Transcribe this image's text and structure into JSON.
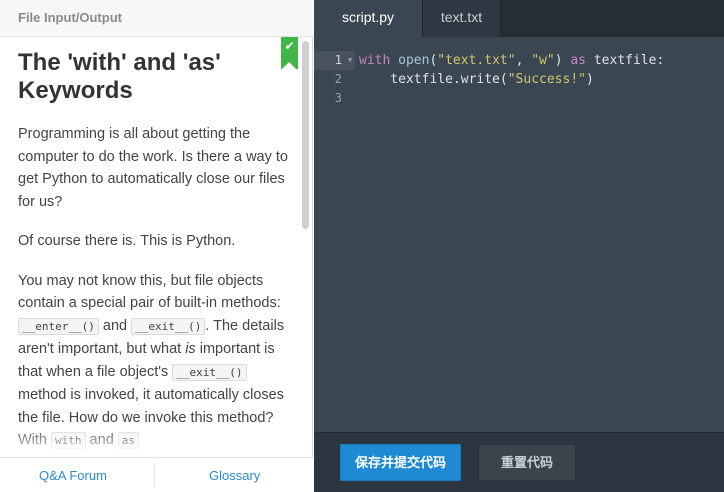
{
  "lesson": {
    "course_title": "File Input/Output",
    "title": "The 'with' and 'as' Keywords",
    "para1": "Programming is all about getting the computer to do the work. Is there a way to get Python to automatically close our files for us?",
    "para2": "Of course there is. This is Python.",
    "para3": {
      "t1": "You may not know this, but file objects contain a special pair of built-in methods: ",
      "c1": "__enter__()",
      "t2": " and ",
      "c2": "__exit__()",
      "t3": ". The details aren't important, but what ",
      "em": "is",
      "t4": " important is that when a file object's ",
      "c3": "__exit__()",
      "t5": " method is invoked, it automatically closes the file. How do we invoke this method? With ",
      "c4": "with",
      "t6": " and ",
      "c5": "as"
    },
    "completed_icon": "check-icon"
  },
  "footer": {
    "qa_label": "Q&A Forum",
    "glossary_label": "Glossary"
  },
  "editor": {
    "tabs": [
      {
        "label": "script.py",
        "active": true
      },
      {
        "label": "text.txt",
        "active": false
      }
    ],
    "line_numbers": [
      "1",
      "2",
      "3"
    ],
    "code": {
      "l1_kw": "with",
      "l1_fn": "open",
      "l1_p1": "(",
      "l1_s1": "\"text.txt\"",
      "l1_p2": ", ",
      "l1_s2": "\"w\"",
      "l1_p3": ") ",
      "l1_kw2": "as",
      "l1_p4": " textfile:",
      "l2_p1": "    textfile.write(",
      "l2_s1": "\"Success!\"",
      "l2_p2": ")"
    }
  },
  "actions": {
    "submit_label": "保存并提交代码",
    "reset_label": "重置代码"
  },
  "colors": {
    "accent": "#1f8ad4",
    "complete": "#42b549",
    "editor_bg": "#3a4652"
  }
}
